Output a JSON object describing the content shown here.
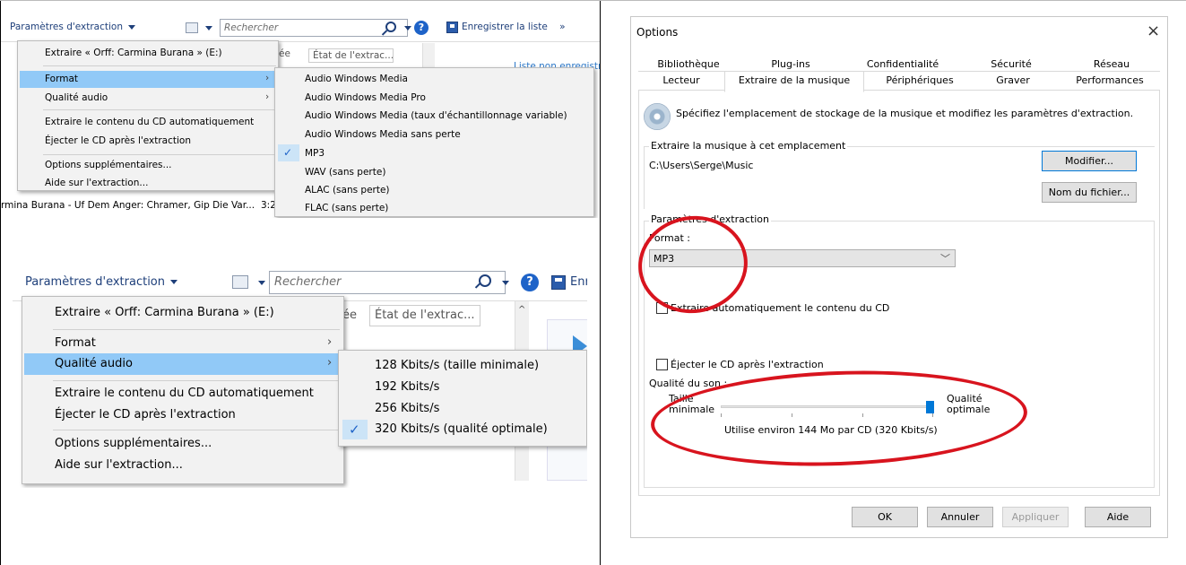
{
  "top_panel": {
    "toolbar": {
      "rip_settings": "Paramètres d'extraction",
      "search_placeholder": "Rechercher",
      "save_list": "Enregistrer la liste",
      "more": "»"
    },
    "bg": {
      "col_header_a": "ée",
      "col_header_b": "État de l'extrac...",
      "list_unsaved": "Liste non enregistr",
      "track_row": "rmina Burana - Uf Dem Anger: Chramer, Gip Die Var...",
      "track_time": "3:2"
    },
    "menu": {
      "rip_cd": "Extraire « Orff: Carmina Burana » (E:)",
      "format": "Format",
      "audio_quality": "Qualité audio",
      "auto_rip": "Extraire le contenu du CD automatiquement",
      "eject": "Éjecter le CD après l'extraction",
      "more_options": "Options supplémentaires...",
      "help": "Aide sur l'extraction..."
    },
    "format_submenu": [
      "Audio Windows Media",
      "Audio Windows Media Pro",
      "Audio Windows Media (taux d'échantillonnage variable)",
      "Audio Windows Media sans perte",
      "MP3",
      "WAV (sans perte)",
      "ALAC (sans perte)",
      "FLAC (sans perte)"
    ]
  },
  "bottom_panel": {
    "toolbar": {
      "rip_settings": "Paramètres d'extraction",
      "search_placeholder": "Rechercher",
      "save_list": "Enr"
    },
    "bg": {
      "col_header_a": "ée",
      "col_header_b": "État de l'extrac..."
    },
    "menu": {
      "rip_cd": "Extraire « Orff: Carmina Burana » (E:)",
      "format": "Format",
      "audio_quality": "Qualité audio",
      "auto_rip": "Extraire le contenu du CD automatiquement",
      "eject": "Éjecter le CD après l'extraction",
      "more_options": "Options supplémentaires...",
      "help": "Aide sur l'extraction..."
    },
    "quality_submenu": [
      "128 Kbits/s (taille minimale)",
      "192 Kbits/s",
      "256 Kbits/s",
      "320 Kbits/s (qualité optimale)"
    ]
  },
  "options_dialog": {
    "title": "Options",
    "close": "×",
    "tabs_row1": [
      "Bibliothèque",
      "Plug-ins",
      "Confidentialité",
      "Sécurité",
      "Réseau"
    ],
    "tabs_row2": [
      "Lecteur",
      "Extraire de la musique",
      "Périphériques",
      "Graver",
      "Performances"
    ],
    "description": "Spécifiez l'emplacement de stockage de la musique et modifiez les paramètres d'extraction.",
    "location_group": "Extraire la musique à cet emplacement",
    "path": "C:\\Users\\Serge\\Music",
    "modify": "Modifier...",
    "file_name": "Nom du fichier...",
    "rip_settings_group": "Paramètres d'extraction",
    "format_label": "Format :",
    "format_value": "MP3",
    "auto_rip": "Extraire automatiquement le contenu du CD",
    "eject": "Éjecter le CD après l'extraction",
    "quality_label": "Qualité du son :",
    "size_min": "Taille minimale",
    "quality_best": "Qualité optimale",
    "usage": "Utilise environ 144 Mo par CD (320 Kbits/s)",
    "quality_level": 1.0,
    "ok": "OK",
    "cancel": "Annuler",
    "apply": "Appliquer",
    "help": "Aide"
  },
  "colors": {
    "highlight": "#91c9f7",
    "annotation": "#d8141e",
    "wmp_blue": "#1e3f7a"
  }
}
